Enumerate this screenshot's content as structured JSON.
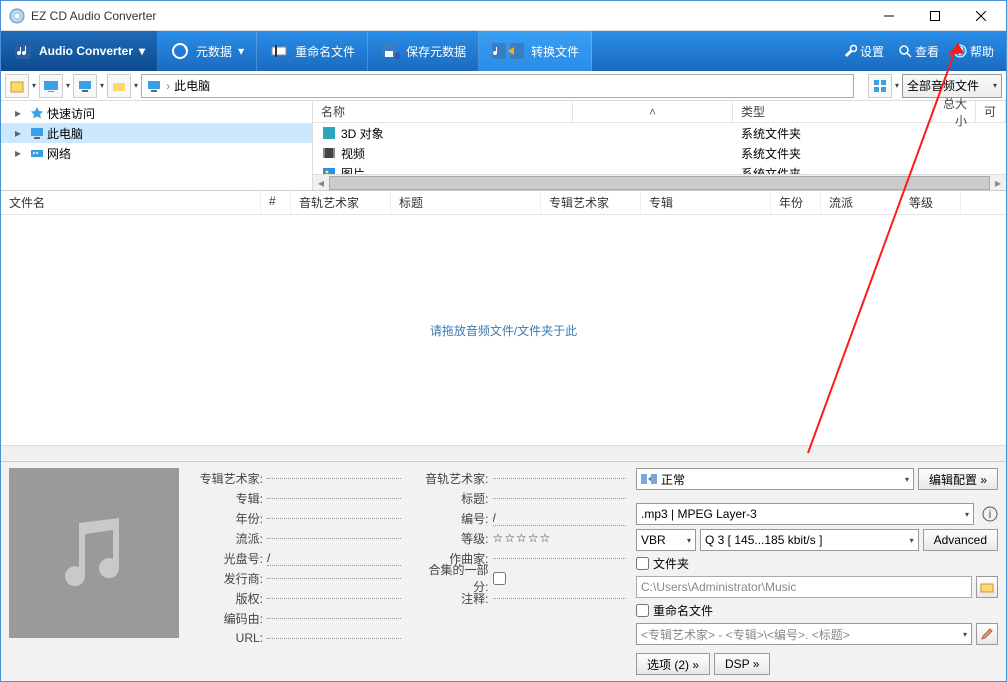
{
  "title": "EZ CD Audio Converter",
  "toolbar": {
    "audio_converter": "Audio Converter",
    "metadata": "元数据",
    "rename": "重命名文件",
    "save_meta": "保存元数据",
    "convert": "转换文件"
  },
  "toolbar_right": {
    "settings": "设置",
    "view": "查看",
    "help": "帮助"
  },
  "nav": {
    "location": "此电脑",
    "filter": "全部音频文件"
  },
  "tree": [
    {
      "label": "快速访问",
      "icon": "star",
      "expand": "▸",
      "sel": false
    },
    {
      "label": "此电脑",
      "icon": "pc",
      "expand": "▸",
      "sel": true
    },
    {
      "label": "网络",
      "icon": "net",
      "expand": "▸",
      "sel": false
    }
  ],
  "folder_cols": {
    "name": "名称",
    "type": "类型",
    "size": "总大小",
    "avail": "可"
  },
  "folder_rows": [
    {
      "name": "3D 对象",
      "type": "系统文件夹",
      "icon": "3d"
    },
    {
      "name": "视频",
      "type": "系统文件夹",
      "icon": "vid"
    },
    {
      "name": "图片",
      "type": "系统文件夹",
      "icon": "pic"
    }
  ],
  "list_cols": [
    "文件名",
    "#",
    "音轨艺术家",
    "标题",
    "专辑艺术家",
    "专辑",
    "年份",
    "流派",
    "等级"
  ],
  "drop_hint": "请拖放音频文件/文件夹于此",
  "meta": {
    "left": [
      {
        "k": "专辑艺术家",
        "v": ""
      },
      {
        "k": "专辑",
        "v": ""
      },
      {
        "k": "年份",
        "v": ""
      },
      {
        "k": "流派",
        "v": ""
      },
      {
        "k": "光盘号",
        "v": "/"
      },
      {
        "k": "发行商",
        "v": ""
      },
      {
        "k": "版权",
        "v": ""
      },
      {
        "k": "编码由",
        "v": ""
      },
      {
        "k": "URL",
        "v": ""
      }
    ],
    "right": [
      {
        "k": "音轨艺术家",
        "v": ""
      },
      {
        "k": "标题",
        "v": ""
      },
      {
        "k": "编号",
        "v": "/"
      },
      {
        "k": "等级",
        "v": "☆☆☆☆☆"
      },
      {
        "k": "作曲家",
        "v": ""
      },
      {
        "k": "合集的一部分",
        "v": "",
        "chk": true
      },
      {
        "k": "注释",
        "v": ""
      }
    ]
  },
  "out": {
    "preset": "正常",
    "edit_cfg": "编辑配置 »",
    "format": ".mp3 | MPEG Layer-3",
    "vbr": "VBR",
    "quality": "Q 3  [ 145...185 kbit/s ]",
    "advanced": "Advanced",
    "folder_chk": "文件夹",
    "folder_path": "C:\\Users\\Administrator\\Music",
    "rename_chk": "重命名文件",
    "rename_tpl": "<专辑艺术家> - <专辑>\\<编号>. <标题>",
    "options": "选项 (2) »",
    "dsp": "DSP »"
  }
}
